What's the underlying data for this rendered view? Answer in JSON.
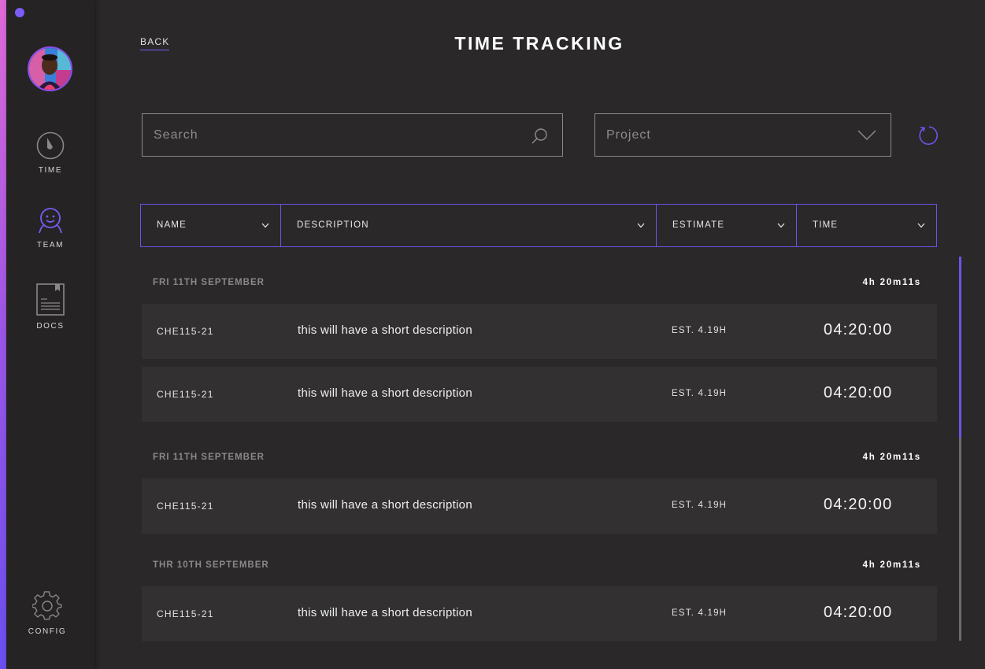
{
  "app": {
    "title": "TIME TRACKING",
    "back_label": "BACK",
    "accent_color": "#6b55e8"
  },
  "sidebar": {
    "items": [
      {
        "label": "TIME",
        "icon": "stopwatch-icon"
      },
      {
        "label": "TEAM",
        "icon": "team-smiley-icon"
      },
      {
        "label": "DOCS",
        "icon": "document-icon"
      },
      {
        "label": "CONFIG",
        "icon": "gear-icon"
      }
    ],
    "avatar": "user-avatar"
  },
  "filters": {
    "search_placeholder": "Search",
    "search_value": "",
    "project_label": "Project"
  },
  "columns": [
    {
      "label": "NAME"
    },
    {
      "label": "DESCRIPTION"
    },
    {
      "label": "ESTIMATE"
    },
    {
      "label": "TIME"
    }
  ],
  "groups": [
    {
      "date": "FRI 11TH SEPTEMBER",
      "total": "4h 20m11s",
      "entries": [
        {
          "name": "CHE115-21",
          "description": "this will have a short description",
          "estimate": "EST. 4.19H",
          "time": "04:20:00"
        },
        {
          "name": "CHE115-21",
          "description": "this will have a short description",
          "estimate": "EST. 4.19H",
          "time": "04:20:00"
        }
      ]
    },
    {
      "date": "FRI 11TH SEPTEMBER",
      "total": "4h 20m11s",
      "entries": [
        {
          "name": "CHE115-21",
          "description": "this will have a short description",
          "estimate": "EST. 4.19H",
          "time": "04:20:00"
        }
      ]
    },
    {
      "date": "THR 10TH SEPTEMBER",
      "total": "4h 20m11s",
      "entries": [
        {
          "name": "CHE115-21",
          "description": "this will have a short description",
          "estimate": "EST. 4.19H",
          "time": "04:20:00"
        }
      ]
    }
  ]
}
